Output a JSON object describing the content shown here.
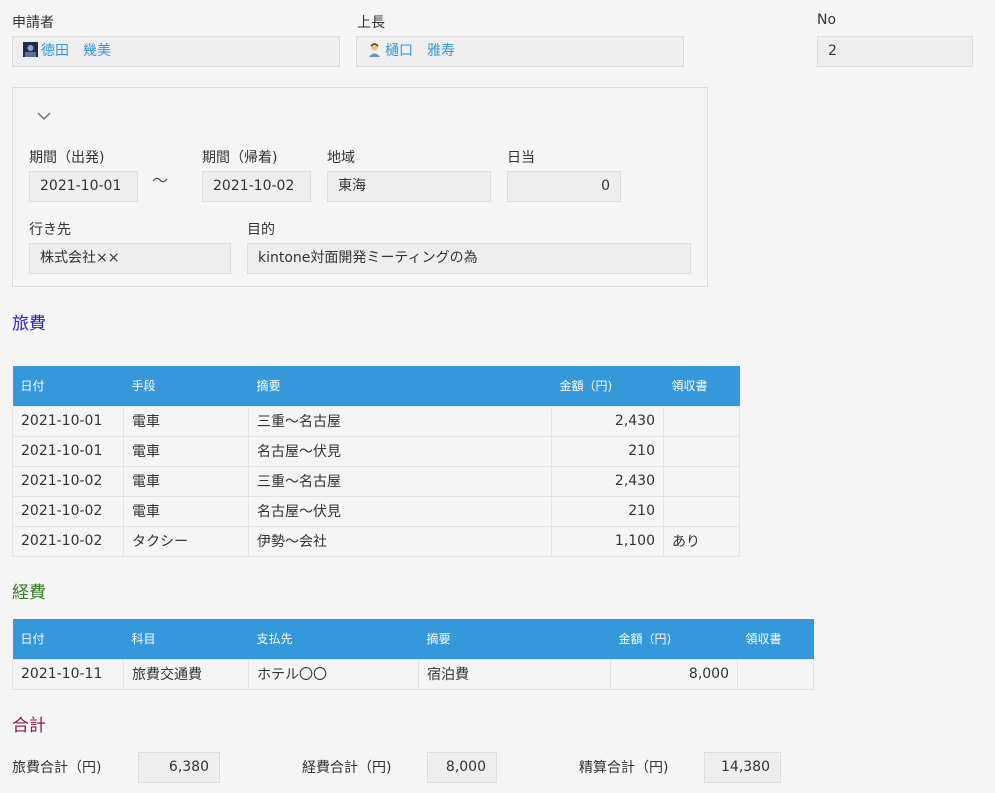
{
  "header": {
    "applicant_label": "申請者",
    "applicant_value": "徳田　幾美",
    "boss_label": "上長",
    "boss_value": "樋口　雅寿",
    "no_label": "No",
    "no_value": "2"
  },
  "trip": {
    "period_start_label": "期間（出発)",
    "period_start_value": "2021-10-01",
    "tilde": "～",
    "period_end_label": "期間（帰着)",
    "period_end_value": "2021-10-02",
    "region_label": "地域",
    "region_value": "東海",
    "daily_label": "日当",
    "daily_value": "0",
    "destination_label": "行き先",
    "destination_value": "株式会社××",
    "purpose_label": "目的",
    "purpose_value": "kintone対面開発ミーティングの為"
  },
  "travel": {
    "title": "旅費",
    "headers": [
      "日付",
      "手段",
      "摘要",
      "金額（円)",
      "領収書"
    ],
    "rows": [
      [
        "2021-10-01",
        "電車",
        "三重～名古屋",
        "2,430",
        ""
      ],
      [
        "2021-10-01",
        "電車",
        "名古屋～伏見",
        "210",
        ""
      ],
      [
        "2021-10-02",
        "電車",
        "三重～名古屋",
        "2,430",
        ""
      ],
      [
        "2021-10-02",
        "電車",
        "名古屋～伏見",
        "210",
        ""
      ],
      [
        "2021-10-02",
        "タクシー",
        "伊勢～会社",
        "1,100",
        "あり"
      ]
    ]
  },
  "expense": {
    "title": "経費",
    "headers": [
      "日付",
      "科目",
      "支払先",
      "摘要",
      "金額（円)",
      "領収書"
    ],
    "rows": [
      [
        "2021-10-11",
        "旅費交通費",
        "ホテル〇〇",
        "宿泊費",
        "8,000",
        ""
      ]
    ]
  },
  "totals": {
    "title": "合計",
    "travel_total_label": "旅費合計（円)",
    "travel_total_value": "6,380",
    "expense_total_label": "経費合計（円)",
    "expense_total_value": "8,000",
    "settlement_total_label": "精算合計（円)",
    "settlement_total_value": "14,380"
  },
  "colors": {
    "accent": "#3498db",
    "travel_title": "#2b26c6",
    "expense_title": "#3a7d2c",
    "total_title": "#8a1a4a"
  }
}
